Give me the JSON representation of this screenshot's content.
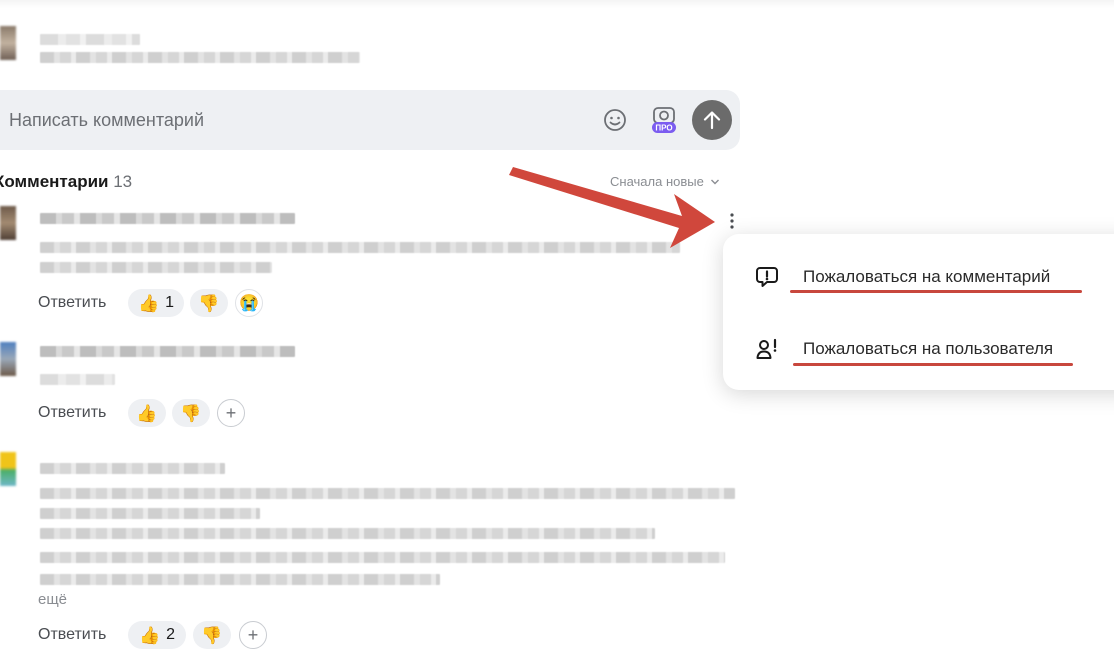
{
  "input": {
    "placeholder": "Написать комментарий"
  },
  "comments_header": {
    "title": "Комментарии",
    "count": "13",
    "sort_label": "Сначала новые"
  },
  "comments": [
    {
      "reply_label": "Ответить",
      "likes": "1",
      "dislikes": ""
    },
    {
      "reply_label": "Ответить",
      "likes": "",
      "dislikes": ""
    },
    {
      "reply_label": "Ответить",
      "likes": "2",
      "dislikes": "",
      "more_label": "ещё"
    }
  ],
  "menu": {
    "items": [
      {
        "label": "Пожаловаться на комментарий",
        "icon": "report-comment-icon"
      },
      {
        "label": "Пожаловаться на пользователя",
        "icon": "report-user-icon"
      }
    ]
  },
  "colors": {
    "accent_red": "#c8473d",
    "arrow_red": "#d0473c",
    "send_button": "#6b6b6b",
    "pill_bg": "#eef0f3"
  },
  "icons": {
    "pro_badge": "ПРО"
  }
}
